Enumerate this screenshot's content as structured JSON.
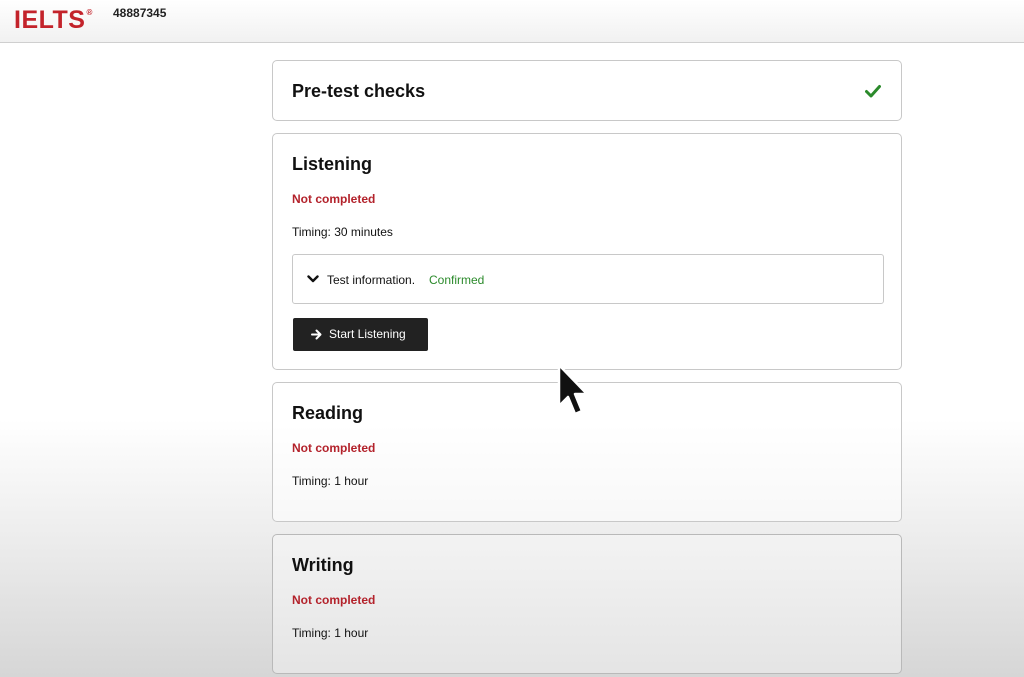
{
  "header": {
    "logo_text": "IELTS",
    "logo_mark": "®",
    "candidate_number": "48887345",
    "brand_color": "#c3232b"
  },
  "pretest": {
    "title": "Pre-test checks",
    "status_icon": "check-icon",
    "status_color": "#2b8a2b"
  },
  "listening": {
    "title": "Listening",
    "status": "Not completed",
    "timing": "Timing: 30 minutes",
    "info": {
      "label": "Test information.",
      "state": "Confirmed",
      "toggle_icon": "chevron-down-icon"
    },
    "start_button": {
      "label": "Start Listening",
      "icon": "arrow-right-icon"
    }
  },
  "reading": {
    "title": "Reading",
    "status": "Not completed",
    "timing": "Timing: 1 hour"
  },
  "writing": {
    "title": "Writing",
    "status": "Not completed",
    "timing": "Timing: 1 hour"
  },
  "colors": {
    "not_completed": "#b3222b",
    "confirmed": "#2b8a2b",
    "button_bg": "#222222"
  }
}
